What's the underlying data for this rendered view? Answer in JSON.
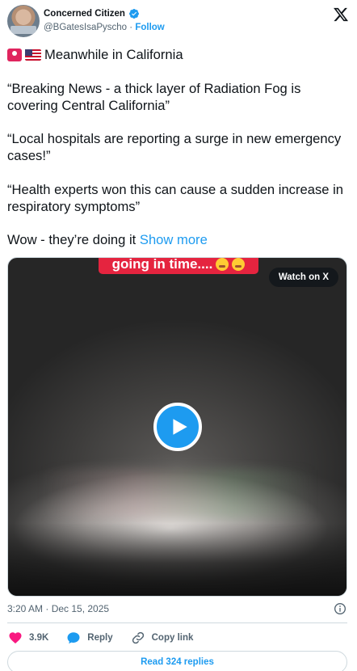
{
  "author": {
    "display_name": "Concerned Citizen",
    "handle": "@BGatesIsaPyscho",
    "separator": "·",
    "follow_label": "Follow",
    "verified_icon": "verified-badge-icon",
    "avatar_icon": "profile-photo"
  },
  "tweet": {
    "line1": "Meanwhile in California",
    "line1_emojis": [
      "siren-emoji",
      "us-flag-emoji"
    ],
    "para2": "“Breaking News - a thick layer of Radiation Fog is covering Central California”",
    "para3": "“Local hospitals are reporting a surge in new emergency cases!”",
    "para4": "“Health experts won this can cause a sudden increase in respiratory symptoms”",
    "para5": "Wow - they’re doing it",
    "show_more_label": "Show more"
  },
  "media": {
    "caption_text": "going in time....",
    "caption_emojis": [
      "weary-face-emoji",
      "face-with-monocle-emoji"
    ],
    "watch_on_x_label": "Watch on X",
    "play_icon": "play-icon"
  },
  "meta": {
    "timestamp": "3:20 AM · Dec 15, 2025",
    "info_icon": "info-icon"
  },
  "actions": {
    "like_count": "3.9K",
    "reply_label": "Reply",
    "copy_link_label": "Copy link"
  },
  "read_replies_label": "Read 324 replies",
  "colors": {
    "accent": "#1d9bf0",
    "like_red": "#f91880",
    "caption_red": "#e5243f",
    "text_primary": "#0f1419",
    "text_secondary": "#536471",
    "border": "#cfd9de"
  }
}
